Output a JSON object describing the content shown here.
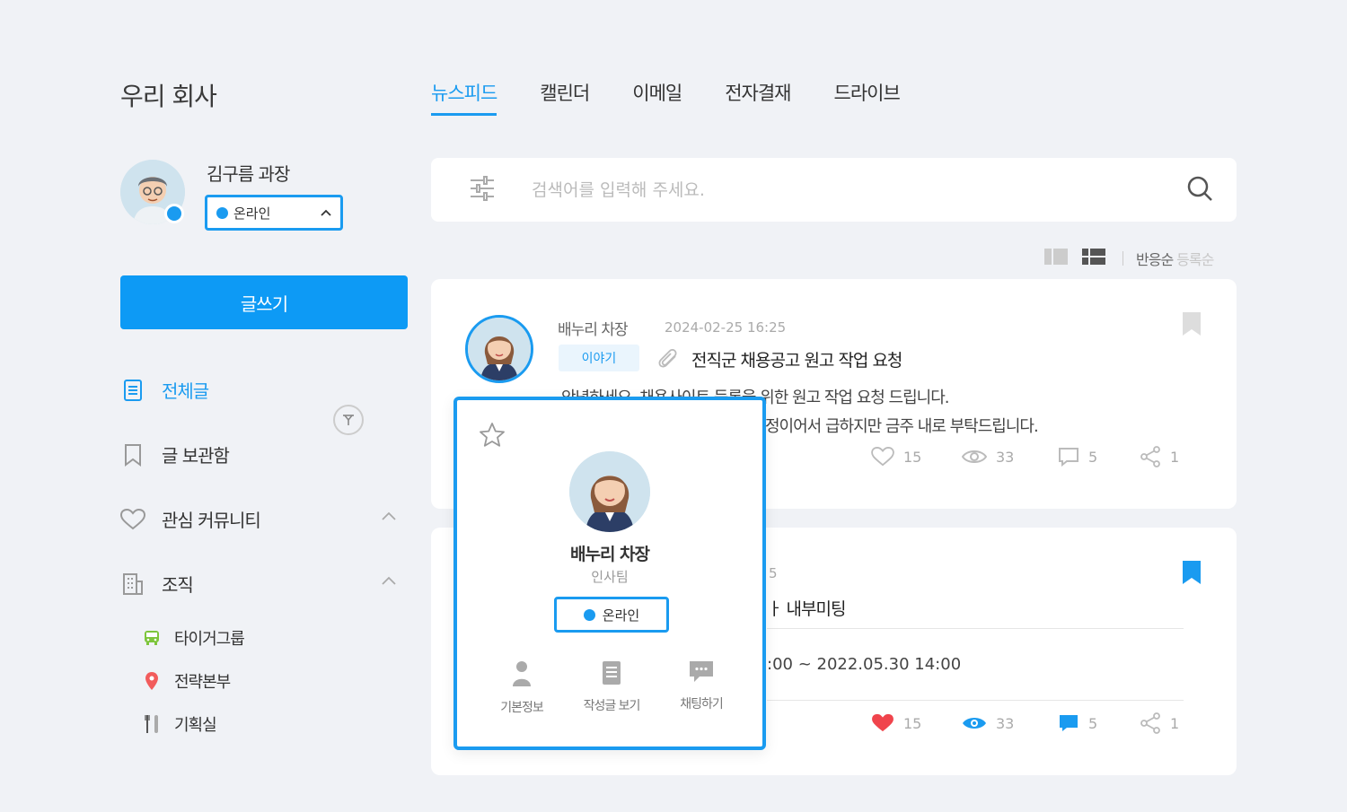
{
  "company": "우리 회사",
  "topnav": {
    "tabs": [
      "뉴스피드",
      "캘린더",
      "이메일",
      "전자결재",
      "드라이브"
    ],
    "active": "뉴스피드"
  },
  "user": {
    "name": "김구름 과장",
    "status": "온라인"
  },
  "write_label": "글쓰기",
  "sidebar": {
    "items": [
      {
        "label": "전체글",
        "icon": "document-icon",
        "active": true
      },
      {
        "label": "글 보관함",
        "icon": "bookmark-icon"
      },
      {
        "label": "관심 커뮤니티",
        "icon": "heart-icon"
      },
      {
        "label": "조직",
        "icon": "building-icon"
      }
    ],
    "org_items": [
      {
        "label": "타이거그룹",
        "icon": "bus-icon"
      },
      {
        "label": "전략본부",
        "icon": "map-pin-icon"
      },
      {
        "label": "기획실",
        "icon": "utensils-icon"
      }
    ]
  },
  "search": {
    "placeholder": "검색어를 입력해 주세요."
  },
  "sort": {
    "active": "반응순",
    "inactive": "등록순"
  },
  "post1": {
    "author": "배누리 차장",
    "time": "2024-02-25 16:25",
    "tag": "이야기",
    "title": "전직군 채용공고 원고 작업 요청",
    "body_line1": "안녕하세요. 채용사이트 등록을 위한 원고 작업 요청 드립니다.",
    "body_line2": "정이어서 급하지만 금주 내로 부탁드립니다.",
    "likes": "15",
    "views": "33",
    "comments": "5",
    "shares": "1"
  },
  "post2": {
    "date_fragment": "5",
    "title_fragment": "ㅏ 내부미팅",
    "range_fragment": ":00 ~ 2022.05.30 14:00",
    "likes": "15",
    "views": "33",
    "comments": "5",
    "shares": "1"
  },
  "popup": {
    "name": "배누리 차장",
    "dept": "인사팀",
    "status": "온라인",
    "actions": [
      "기본정보",
      "작성글 보기",
      "채팅하기"
    ]
  },
  "colors": {
    "accent": "#1a9bf0",
    "primary_button": "#0d9af5",
    "like_active": "#f0444c",
    "background": "#f0f2f6"
  }
}
